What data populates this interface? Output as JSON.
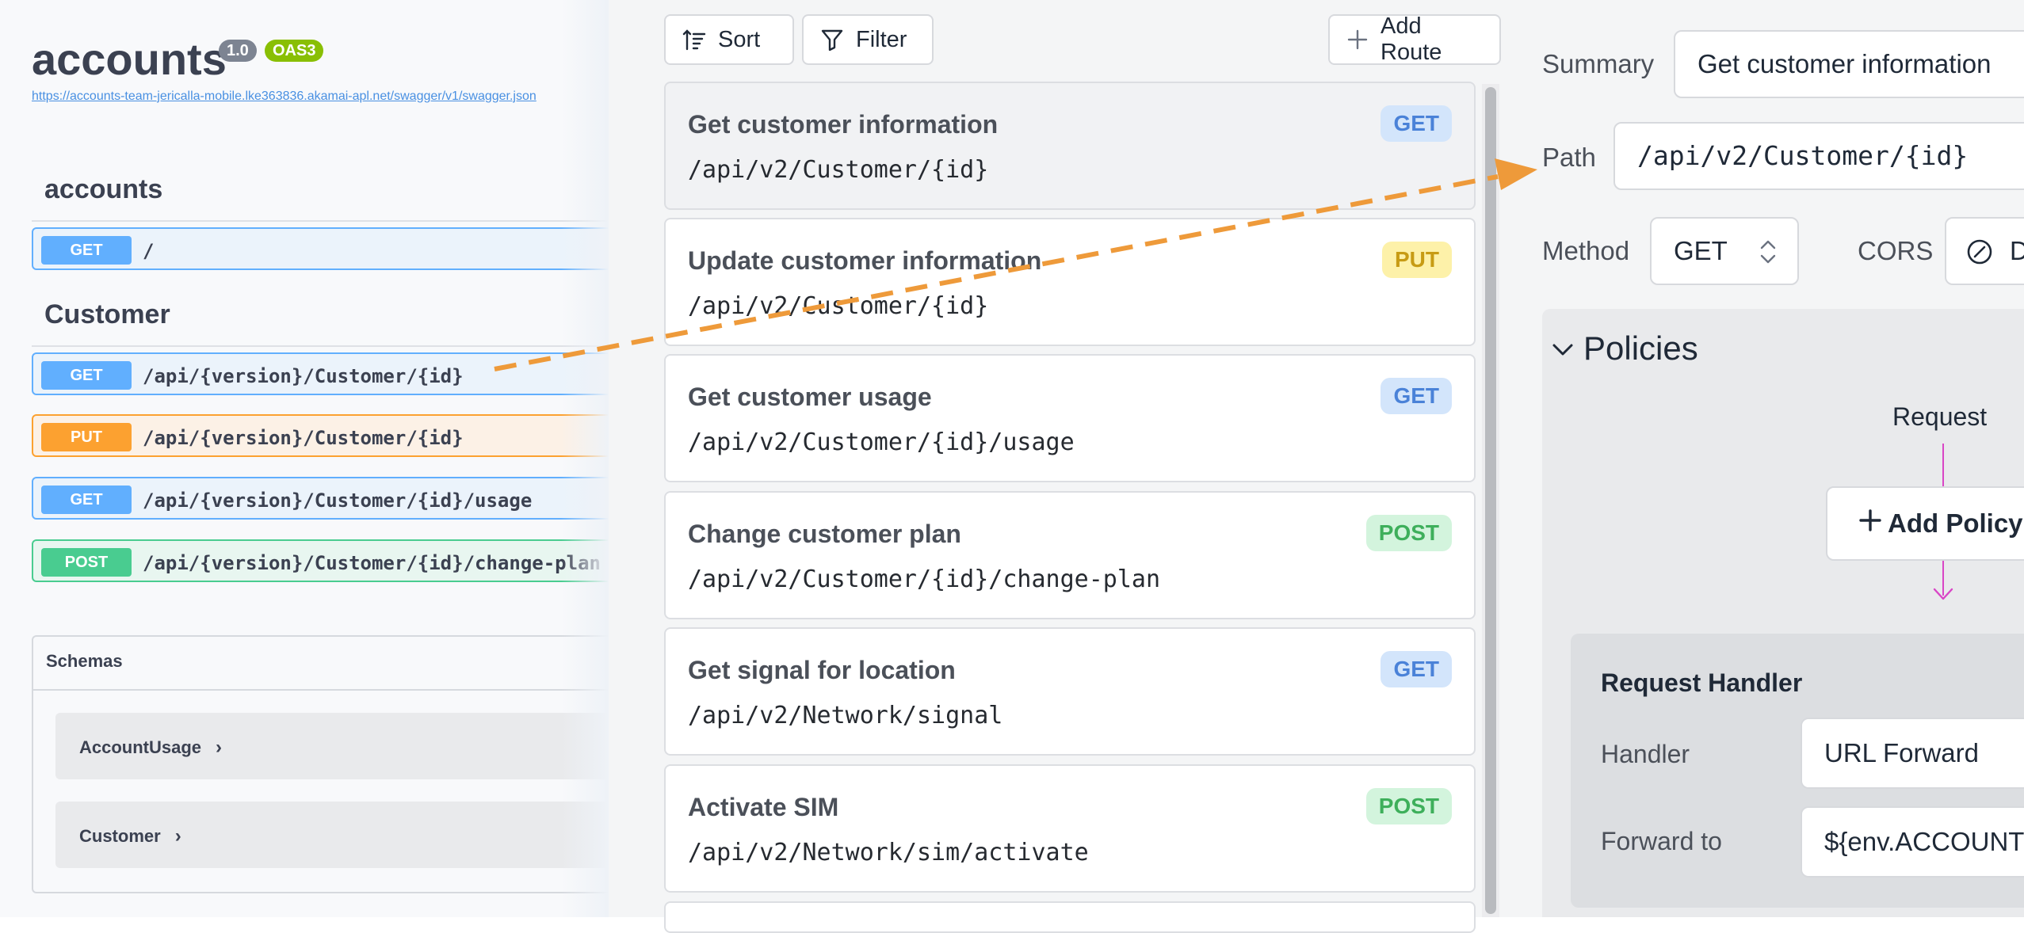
{
  "swagger": {
    "title": "accounts",
    "version_badge": "1.0",
    "oas_badge": "OAS3",
    "spec_url": "https://accounts-team-jericalla-mobile.lke363836.akamai-apl.net/swagger/v1/swagger.json",
    "sections": [
      {
        "name": "accounts",
        "operations": [
          {
            "method": "GET",
            "path": "/"
          }
        ]
      },
      {
        "name": "Customer",
        "operations": [
          {
            "method": "GET",
            "path": "/api/{version}/Customer/{id}"
          },
          {
            "method": "PUT",
            "path": "/api/{version}/Customer/{id}"
          },
          {
            "method": "GET",
            "path": "/api/{version}/Customer/{id}/usage"
          },
          {
            "method": "POST",
            "path": "/api/{version}/Customer/{id}/change-plan"
          }
        ]
      }
    ],
    "schemas": {
      "heading": "Schemas",
      "models": [
        "AccountUsage",
        "Customer"
      ]
    },
    "colors": {
      "get": "#61affe",
      "put": "#fca130",
      "post": "#49cc90"
    }
  },
  "routes": {
    "toolbar": {
      "sort_label": "Sort",
      "filter_label": "Filter",
      "add_route_label": "Add Route"
    },
    "items": [
      {
        "name": "Get customer information",
        "path": "/api/v2/Customer/{id}",
        "method": "GET",
        "active": true
      },
      {
        "name": "Update customer information",
        "path": "/api/v2/Customer/{id}",
        "method": "PUT"
      },
      {
        "name": "Get customer usage",
        "path": "/api/v2/Customer/{id}/usage",
        "method": "GET"
      },
      {
        "name": "Change customer plan",
        "path": "/api/v2/Customer/{id}/change-plan",
        "method": "POST"
      },
      {
        "name": "Get signal for location",
        "path": "/api/v2/Network/signal",
        "method": "GET"
      },
      {
        "name": "Activate SIM",
        "path": "/api/v2/Network/sim/activate",
        "method": "POST"
      }
    ]
  },
  "editor": {
    "summary_label": "Summary",
    "summary_value": "Get customer information",
    "path_label": "Path",
    "path_value": "/api/v2/Customer/{id}",
    "method_label": "Method",
    "method_value": "GET",
    "cors_label": "CORS",
    "cors_value": "D",
    "policies_title": "Policies",
    "request_label": "Request",
    "add_policy_label": "Add Policy",
    "request_handler_title": "Request Handler",
    "handler_label": "Handler",
    "handler_value": "URL Forward",
    "forward_to_label": "Forward to",
    "forward_to_value": "${env.ACCOUNT"
  },
  "annotation": {
    "arrow_color": "#ee9a3a",
    "flow_color": "#d946c6"
  }
}
